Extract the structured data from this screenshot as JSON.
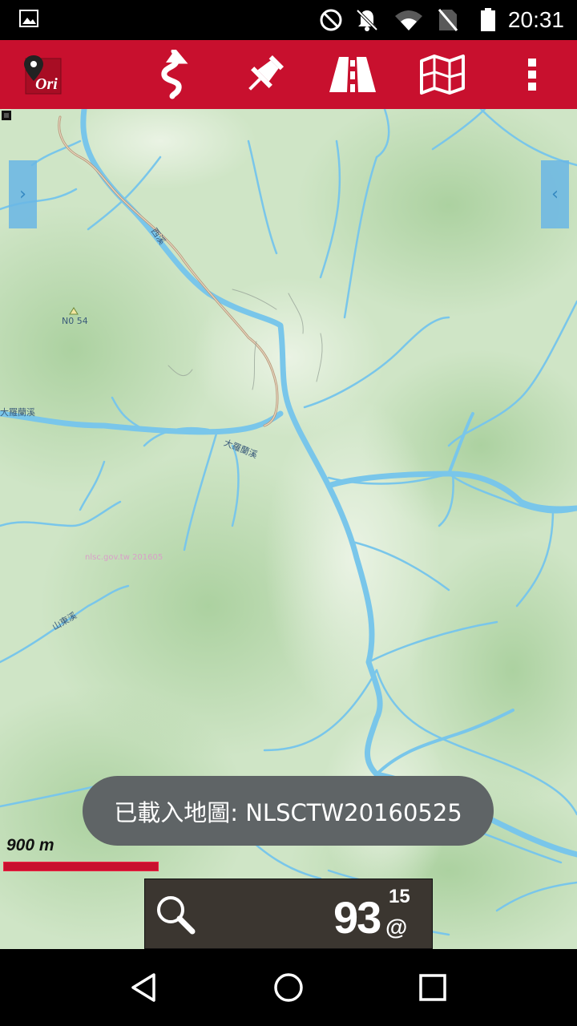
{
  "status_bar": {
    "time": "20:31",
    "icons": [
      "image-icon",
      "dnd-icon",
      "notifications-off-icon",
      "wifi-icon",
      "no-sim-icon",
      "battery-icon"
    ]
  },
  "toolbar": {
    "app_logo_text": "Ori",
    "buttons": [
      "route-icon",
      "pin-icon",
      "road-icon",
      "map-icon",
      "more-vert-icon"
    ],
    "accent_color": "#c8102e"
  },
  "map": {
    "left_tab_glyph": "›",
    "right_tab_glyph": "‹",
    "labels": {
      "peak": "N0 54",
      "river1": "大羅蘭溪",
      "river2": "大羅蘭溪",
      "river3": "山東溪",
      "river4": "西溪",
      "watermark": "nlsc.gov.tw 201605"
    }
  },
  "toast": {
    "text": "已載入地圖: NLSCTW20160525"
  },
  "scale": {
    "label": "900 m"
  },
  "search": {
    "count": "93",
    "zoom_superscript": "15",
    "at_symbol": "@"
  },
  "navigation": {
    "buttons": [
      "back-icon",
      "home-icon",
      "recents-icon"
    ]
  }
}
